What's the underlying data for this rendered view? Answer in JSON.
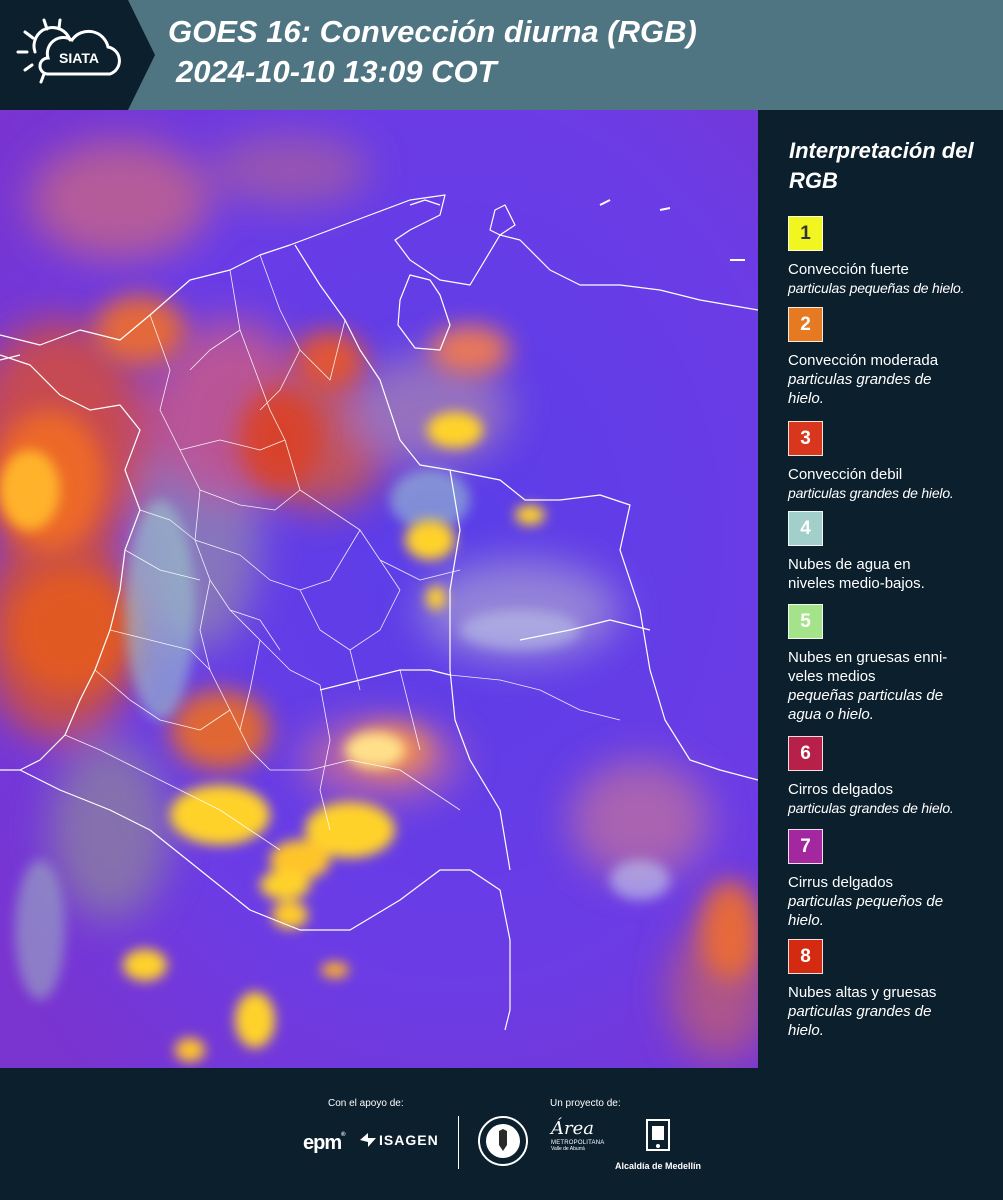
{
  "header": {
    "logo_text": "SIATA",
    "title_line1": "GOES 16: Convección diurna (RGB)",
    "title_line2": "2024-10-10 13:09 COT"
  },
  "map": {
    "background_color": "#6b3ce6",
    "border_color": "#ffffff",
    "cloud_colors": {
      "strong_convection": "#ffd22a",
      "moderate_convection": "#f07a2a",
      "weak_convection": "#e0482e",
      "mid_low_water": "#9fd0cc",
      "ice_cirrus": "#c85a8a"
    }
  },
  "legend": {
    "title": "Interpretación del RGB",
    "items": [
      {
        "number": "1",
        "color": "#f1f520",
        "text_color": "#333333",
        "label": "Convección fuerte",
        "description": "particulas pequeñas de hielo."
      },
      {
        "number": "2",
        "color": "#e57a22",
        "text_color": "#ffffff",
        "label": "Convección moderada",
        "description": "particulas grandes de hielo."
      },
      {
        "number": "3",
        "color": "#d9361e",
        "text_color": "#ffffff",
        "label": "Convección debil",
        "description": "particulas grandes de hielo."
      },
      {
        "number": "4",
        "color": "#a3cfcb",
        "text_color": "#ffffff",
        "label": "Nubes de agua en niveles medio-bajos.",
        "description": ""
      },
      {
        "number": "5",
        "color": "#a5e38b",
        "text_color": "#ffffff",
        "label": "Nubes en gruesas enni-veles medios",
        "description": "pequeñas particulas de agua o hielo."
      },
      {
        "number": "6",
        "color": "#b72048",
        "text_color": "#ffffff",
        "label": "Cirros delgados",
        "description": "particulas grandes de hielo."
      },
      {
        "number": "7",
        "color": "#a328a0",
        "text_color": "#ffffff",
        "label": "Cirrus delgados",
        "description": "particulas pequeños de hielo."
      },
      {
        "number": "8",
        "color": "#d42a12",
        "text_color": "#ffffff",
        "label": "Nubes altas y gruesas",
        "description": "particulas grandes de hielo."
      }
    ]
  },
  "footer": {
    "support_label": "Con el apoyo de:",
    "project_label": "Un proyecto de:",
    "epm": "epm",
    "isagen": "ISAGEN",
    "area_word": "Área",
    "area_sub1": "METROPOLITANA",
    "area_sub2": "Valle de Aburrá",
    "alcaldia": "Alcaldía de Medellín"
  }
}
